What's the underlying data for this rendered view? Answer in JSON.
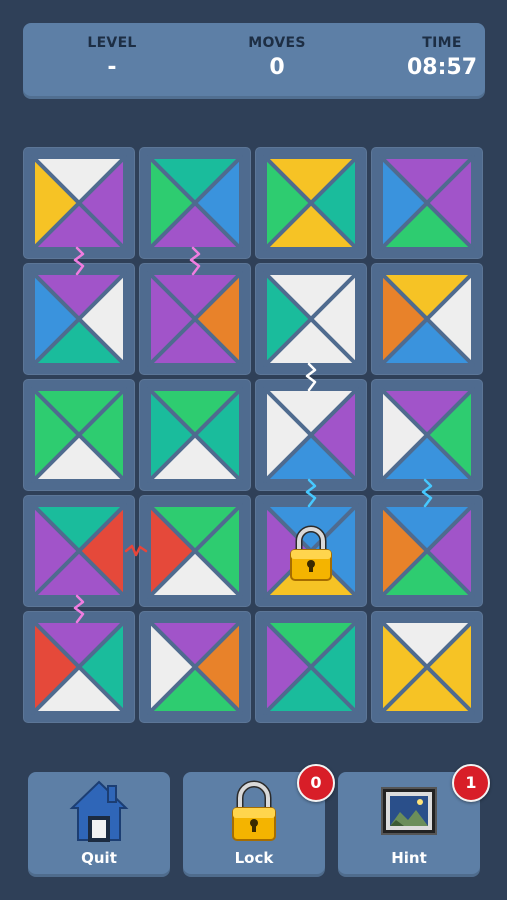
{
  "stats": {
    "level_label": "LEVEL",
    "level_value": "-",
    "moves_label": "MOVES",
    "moves_value": "0",
    "time_label": "TIME",
    "time_value": "08:57"
  },
  "colors": {
    "white": "#eeeeee",
    "yellow": "#f6c325",
    "purple": "#a154c9",
    "green": "#2ecc70",
    "blue": "#3a93dd",
    "teal": "#1abc9c",
    "orange": "#e8822a",
    "red": "#e5493a",
    "link": "#f07de0",
    "link_white": "#ffffff",
    "link_cyan": "#46c8ff",
    "link_red": "#e8453a"
  },
  "board": {
    "rows": 5,
    "cols": 4,
    "tiles": [
      {
        "top": "white",
        "right": "purple",
        "bottom": "purple",
        "left": "yellow"
      },
      {
        "top": "teal",
        "right": "blue",
        "bottom": "purple",
        "left": "green"
      },
      {
        "top": "yellow",
        "right": "teal",
        "bottom": "yellow",
        "left": "green"
      },
      {
        "top": "purple",
        "right": "purple",
        "bottom": "green",
        "left": "blue"
      },
      {
        "top": "purple",
        "right": "white",
        "bottom": "teal",
        "left": "blue"
      },
      {
        "top": "purple",
        "right": "orange",
        "bottom": "purple",
        "left": "purple"
      },
      {
        "top": "white",
        "right": "white",
        "bottom": "white",
        "left": "teal"
      },
      {
        "top": "yellow",
        "right": "white",
        "bottom": "blue",
        "left": "orange"
      },
      {
        "top": "green",
        "right": "green",
        "bottom": "white",
        "left": "green"
      },
      {
        "top": "green",
        "right": "teal",
        "bottom": "white",
        "left": "teal"
      },
      {
        "top": "white",
        "right": "purple",
        "bottom": "blue",
        "left": "white"
      },
      {
        "top": "purple",
        "right": "green",
        "bottom": "blue",
        "left": "white"
      },
      {
        "top": "teal",
        "right": "red",
        "bottom": "purple",
        "left": "purple"
      },
      {
        "top": "green",
        "right": "green",
        "bottom": "white",
        "left": "red"
      },
      {
        "top": "blue",
        "right": "blue",
        "bottom": "yellow",
        "left": "purple",
        "locked": true
      },
      {
        "top": "blue",
        "right": "purple",
        "bottom": "green",
        "left": "orange"
      },
      {
        "top": "purple",
        "right": "teal",
        "bottom": "white",
        "left": "red"
      },
      {
        "top": "purple",
        "right": "orange",
        "bottom": "green",
        "left": "white"
      },
      {
        "top": "green",
        "right": "teal",
        "bottom": "teal",
        "left": "purple"
      },
      {
        "top": "white",
        "right": "yellow",
        "bottom": "yellow",
        "left": "yellow"
      }
    ],
    "links": [
      {
        "color": "link",
        "between": [
          0,
          4
        ]
      },
      {
        "color": "link",
        "between": [
          1,
          5
        ]
      },
      {
        "color": "link_white",
        "between": [
          6,
          10
        ]
      },
      {
        "color": "link_cyan",
        "between": [
          10,
          14
        ]
      },
      {
        "color": "link_cyan",
        "between": [
          11,
          15
        ]
      },
      {
        "color": "link_red",
        "between": [
          12,
          13
        ]
      },
      {
        "color": "link",
        "between": [
          12,
          16
        ]
      }
    ]
  },
  "buttons": {
    "quit": {
      "label": "Quit",
      "icon": "house-icon"
    },
    "lock": {
      "label": "Lock",
      "icon": "padlock-icon",
      "count": "0"
    },
    "hint": {
      "label": "Hint",
      "icon": "framed-picture-icon",
      "count": "1"
    }
  }
}
